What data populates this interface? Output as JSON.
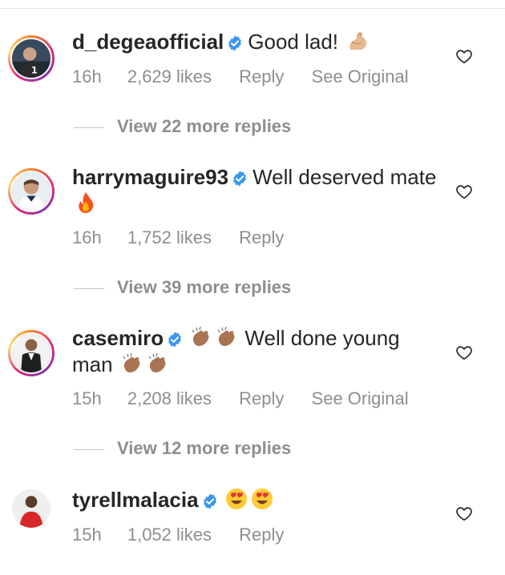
{
  "comments": [
    {
      "username": "d_degeaofficial",
      "text": "Good lad!",
      "emoji": "flexed-biceps",
      "time": "16h",
      "likes": "2,629 likes",
      "reply": "Reply",
      "see_original": "See Original",
      "view_replies": "View 22 more replies"
    },
    {
      "username": "harrymaguire93",
      "text": "Well deserved mate",
      "emoji": "fire",
      "time": "16h",
      "likes": "1,752 likes",
      "reply": "Reply",
      "view_replies": "View 39 more replies"
    },
    {
      "username": "casemiro",
      "text": "Well done young man",
      "emoji": "clapping-hands",
      "time": "15h",
      "likes": "2,208 likes",
      "reply": "Reply",
      "see_original": "See Original",
      "view_replies": "View 12 more replies"
    },
    {
      "username": "tyrellmalacia",
      "text": "",
      "emoji": "heart-eyes",
      "time": "15h",
      "likes": "1,052 likes",
      "reply": "Reply"
    }
  ],
  "colors": {
    "verified": "#3897f0",
    "meta_text": "#8e8e8e",
    "primary_text": "#262626"
  }
}
